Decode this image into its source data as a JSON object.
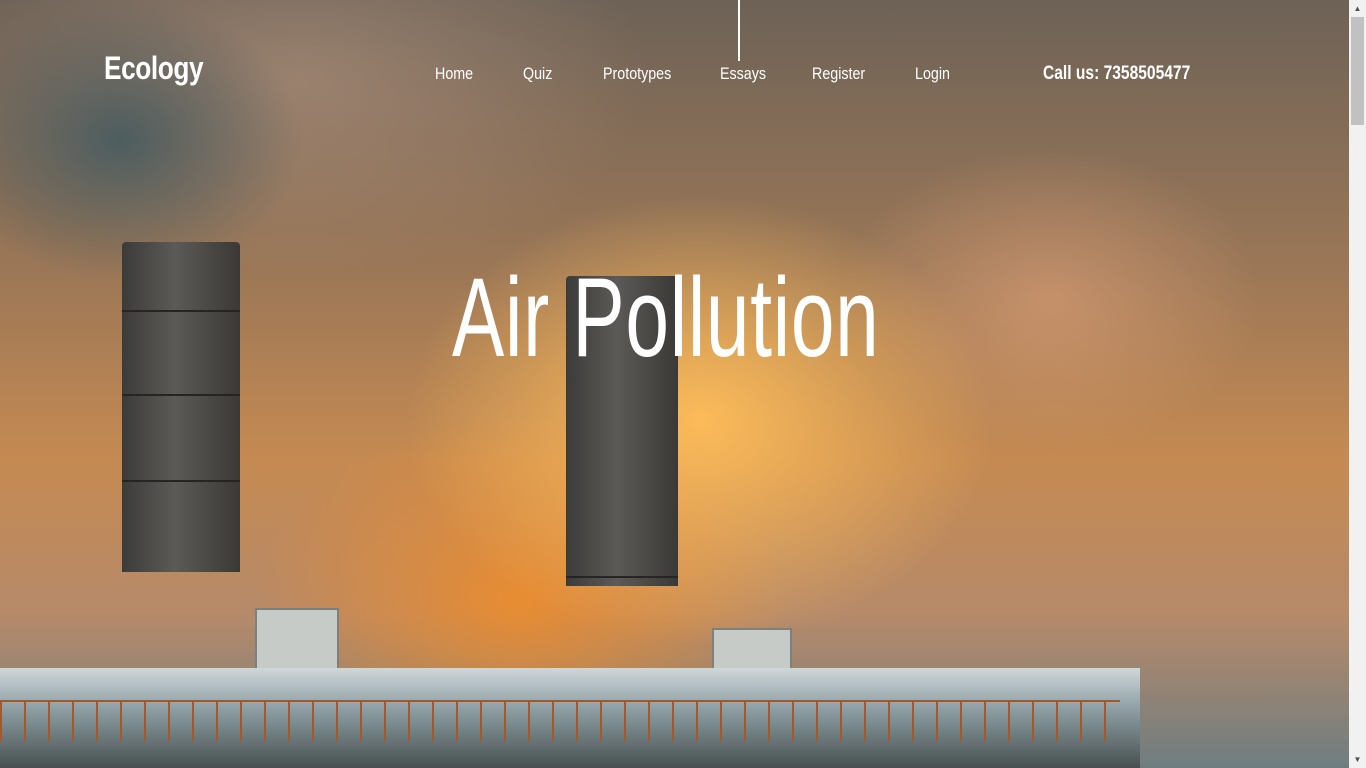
{
  "header": {
    "brand": "Ecology",
    "nav": [
      {
        "label": "Home"
      },
      {
        "label": "Quiz"
      },
      {
        "label": "Prototypes"
      },
      {
        "label": "Essays"
      },
      {
        "label": "Register"
      },
      {
        "label": "Login"
      }
    ],
    "active_item": "Essays",
    "phone": "Call us: 7358505477"
  },
  "hero": {
    "title": "Air Pollution",
    "background_image": "factory smokestacks emitting smoke at sunset"
  },
  "colors": {
    "text": "#ffffff",
    "sky_orange": "#e08a3c",
    "smoke_gray": "#5c5a56"
  }
}
